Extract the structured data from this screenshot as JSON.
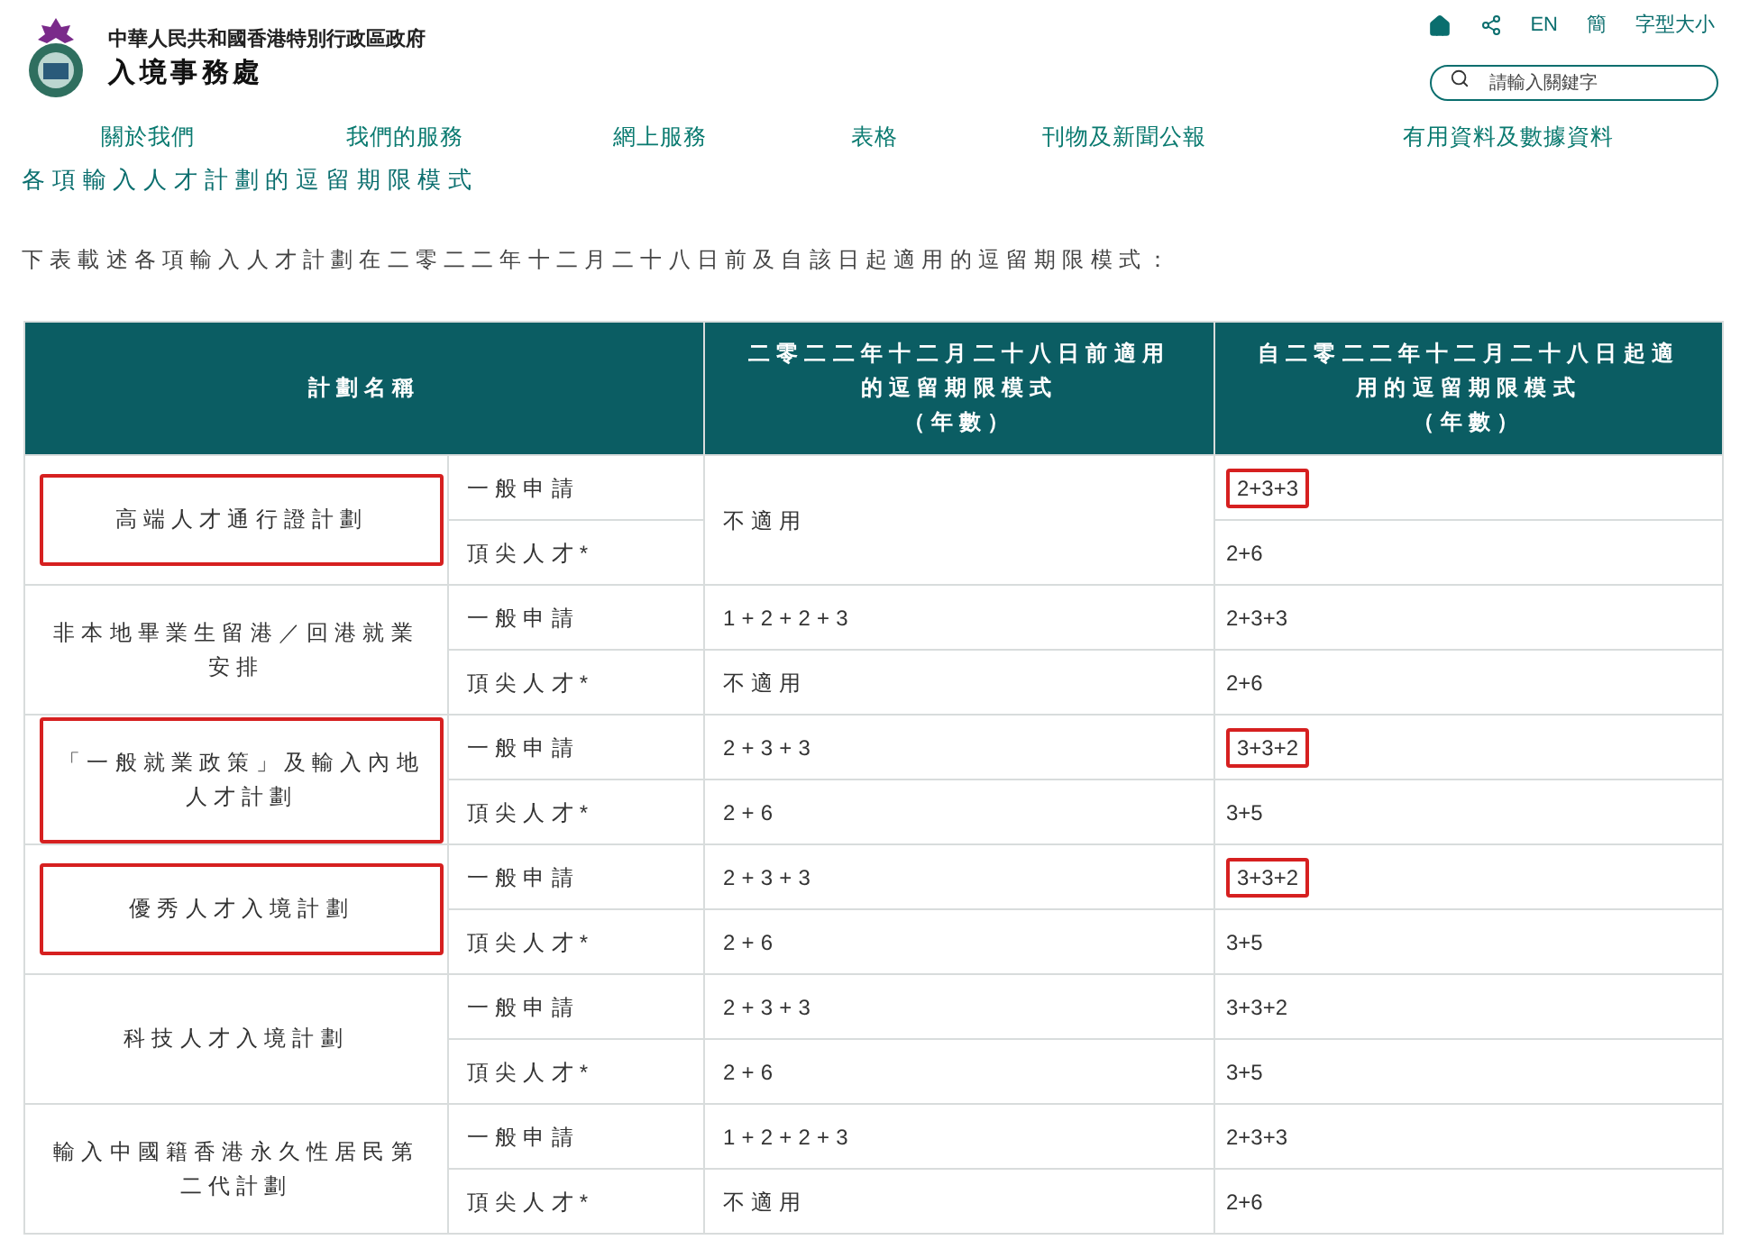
{
  "header": {
    "org_line": "中華人民共和國香港特別行政區政府",
    "dept_name": "入境事務處",
    "tools": [
      {
        "kind": "home"
      },
      {
        "kind": "share"
      },
      {
        "kind": "text",
        "label": "EN"
      },
      {
        "kind": "text",
        "label": "簡"
      },
      {
        "kind": "text",
        "label": "字型大小"
      }
    ],
    "search": {
      "placeholder": "請輸入關鍵字"
    }
  },
  "nav": [
    "關於我們",
    "我們的服務",
    "網上服務",
    "表格",
    "刊物及新聞公報",
    "有用資料及數據資料"
  ],
  "page_title": "各項輸入人才計劃的逗留期限模式",
  "intro": "下表載述各項輸入人才計劃在二零二二年十二月二十八日前及自該日起適用的逗留期限模式：",
  "table": {
    "columns": [
      {
        "title": "計劃名稱"
      },
      {
        "title": "二零二二年十二月二十八日前適用的逗留期限模式",
        "unit": "（年數）"
      },
      {
        "title": "自二零二二年十二月二十八日起適用的逗留期限模式",
        "unit": "（年數）"
      }
    ],
    "plans": [
      {
        "name": "高端人才通行證計劃",
        "highlighted": true,
        "before": "不適用",
        "rows": [
          {
            "category": "一般申請",
            "after": "2+3+3",
            "highlighted": true
          },
          {
            "category": "頂尖人才*",
            "after": "2+6",
            "highlighted": false
          }
        ]
      },
      {
        "name": "非本地畢業生留港／回港就業安排",
        "highlighted": false,
        "rows": [
          {
            "category": "一般申請",
            "before": "1+2+2+3",
            "after": "2+3+3",
            "highlighted": false
          },
          {
            "category": "頂尖人才*",
            "before": "不適用",
            "after": "2+6",
            "highlighted": false
          }
        ]
      },
      {
        "name": "「一般就業政策」及輸入內地人才計劃",
        "highlighted": true,
        "rows": [
          {
            "category": "一般申請",
            "before": "2+3+3",
            "after": "3+3+2",
            "highlighted": true
          },
          {
            "category": "頂尖人才*",
            "before": "2+6",
            "after": "3+5",
            "highlighted": false
          }
        ]
      },
      {
        "name": "優秀人才入境計劃",
        "highlighted": true,
        "rows": [
          {
            "category": "一般申請",
            "before": "2+3+3",
            "after": "3+3+2",
            "highlighted": true
          },
          {
            "category": "頂尖人才*",
            "before": "2+6",
            "after": "3+5",
            "highlighted": false
          }
        ]
      },
      {
        "name": "科技人才入境計劃",
        "highlighted": false,
        "rows": [
          {
            "category": "一般申請",
            "before": "2+3+3",
            "after": "3+3+2",
            "highlighted": false
          },
          {
            "category": "頂尖人才*",
            "before": "2+6",
            "after": "3+5",
            "highlighted": false
          }
        ]
      },
      {
        "name": "輸入中國籍香港永久性居民第二代計劃",
        "highlighted": false,
        "rows": [
          {
            "category": "一般申請",
            "before": "1+2+2+3",
            "after": "2+3+3",
            "highlighted": false
          },
          {
            "category": "頂尖人才*",
            "before": "不適用",
            "after": "2+6",
            "highlighted": false
          }
        ]
      }
    ]
  }
}
